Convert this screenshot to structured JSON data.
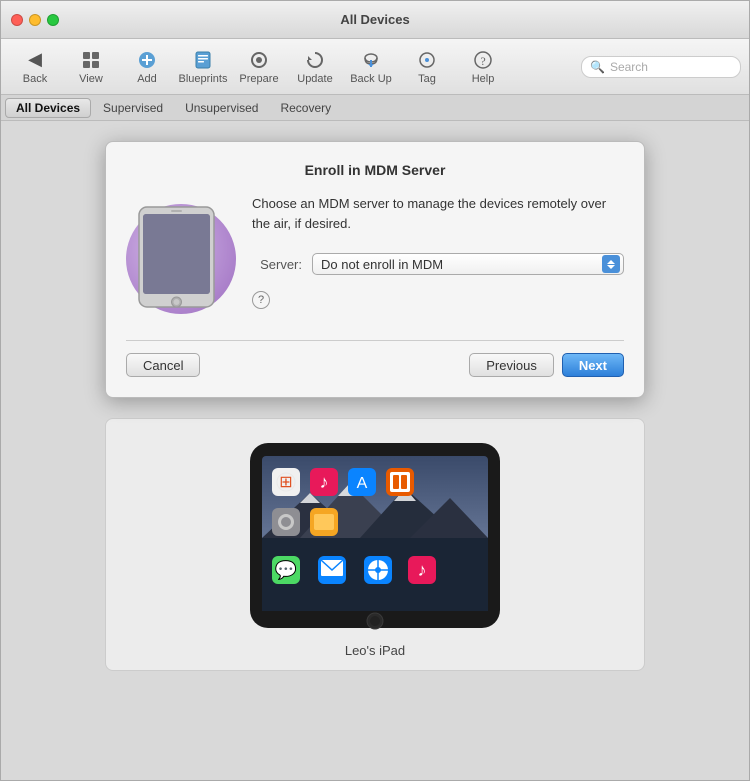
{
  "window": {
    "title": "All Devices"
  },
  "toolbar": {
    "back_label": "Back",
    "view_label": "View",
    "add_label": "Add",
    "blueprints_label": "Blueprints",
    "prepare_label": "Prepare",
    "update_label": "Update",
    "backup_label": "Back Up",
    "tag_label": "Tag",
    "help_label": "Help",
    "search_placeholder": "Search"
  },
  "tabs": [
    {
      "label": "All Devices",
      "active": true
    },
    {
      "label": "Supervised",
      "active": false
    },
    {
      "label": "Unsupervised",
      "active": false
    },
    {
      "label": "Recovery",
      "active": false
    }
  ],
  "modal": {
    "title": "Enroll in MDM Server",
    "description": "Choose an MDM server to manage the devices remotely over the air, if desired.",
    "server_label": "Server:",
    "server_value": "Do not enroll in MDM",
    "server_options": [
      "Do not enroll in MDM"
    ],
    "cancel_label": "Cancel",
    "previous_label": "Previous",
    "next_label": "Next"
  },
  "device": {
    "label": "Leo's iPad"
  },
  "icons": {
    "back": "◀",
    "view": "⊞",
    "add": "+",
    "blueprints": "⊡",
    "prepare": "⚙",
    "update": "↻",
    "backup": "☁",
    "tag": "⌀",
    "help": "?",
    "search": "🔍",
    "help_circle": "?"
  },
  "colors": {
    "accent": "#4a90d9",
    "tab_active_bg": "#e0e0e0"
  }
}
